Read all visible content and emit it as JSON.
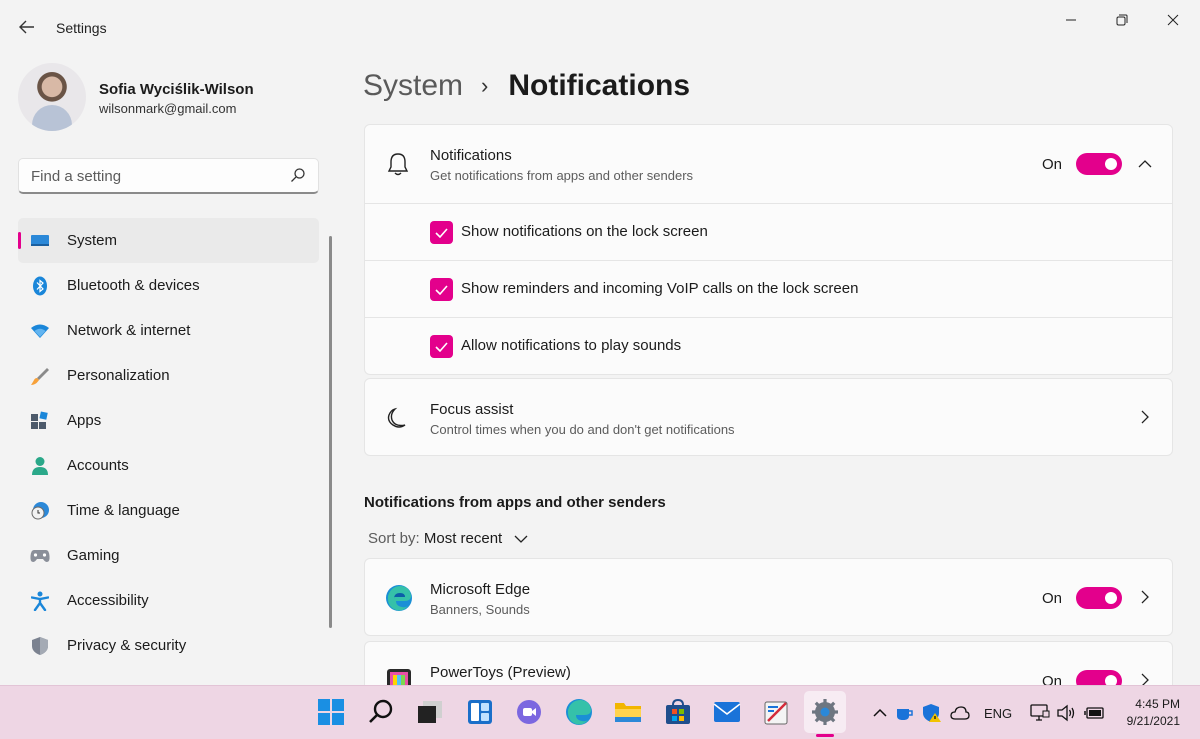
{
  "window": {
    "title": "Settings",
    "back_icon": "back-arrow-icon",
    "controls": [
      "minimize-icon",
      "maximize-icon",
      "close-icon"
    ]
  },
  "profile": {
    "name": "Sofia Wyciślik-Wilson",
    "email": "wilsonmark@gmail.com"
  },
  "search": {
    "placeholder": "Find a setting",
    "icon": "search-icon"
  },
  "sidebar": {
    "items": [
      {
        "label": "System",
        "icon": "system-display-icon",
        "active": true
      },
      {
        "label": "Bluetooth & devices",
        "icon": "bluetooth-icon"
      },
      {
        "label": "Network & internet",
        "icon": "wifi-icon"
      },
      {
        "label": "Personalization",
        "icon": "brush-icon"
      },
      {
        "label": "Apps",
        "icon": "apps-icon"
      },
      {
        "label": "Accounts",
        "icon": "accounts-icon"
      },
      {
        "label": "Time & language",
        "icon": "clock-globe-icon"
      },
      {
        "label": "Gaming",
        "icon": "gamepad-icon"
      },
      {
        "label": "Accessibility",
        "icon": "accessibility-icon"
      },
      {
        "label": "Privacy & security",
        "icon": "shield-icon"
      }
    ]
  },
  "breadcrumb": {
    "parent": "System",
    "separator": "›",
    "current": "Notifications"
  },
  "notifications_card": {
    "title": "Notifications",
    "subtitle": "Get notifications from apps and other senders",
    "state_label": "On",
    "toggle_on": true,
    "icon": "bell-icon",
    "options": [
      {
        "label": "Show notifications on the lock screen",
        "checked": true
      },
      {
        "label": "Show reminders and incoming VoIP calls on the lock screen",
        "checked": true
      },
      {
        "label": "Allow notifications to play sounds",
        "checked": true
      }
    ]
  },
  "focus_assist": {
    "title": "Focus assist",
    "subtitle": "Control times when you do and don't get notifications",
    "icon": "moon-icon"
  },
  "apps_section": {
    "title": "Notifications from apps and other senders",
    "sort_label": "Sort by:",
    "sort_value": "Most recent",
    "apps": [
      {
        "name": "Microsoft Edge",
        "detail": "Banners, Sounds",
        "state_label": "On",
        "toggle_on": true,
        "icon": "edge-icon"
      },
      {
        "name": "PowerToys (Preview)",
        "detail": "",
        "state_label": "On",
        "toggle_on": true,
        "icon": "powertoys-icon"
      }
    ]
  },
  "taskbar": {
    "icons": [
      "start-icon",
      "search-icon",
      "task-view-icon",
      "widgets-icon",
      "chat-icon",
      "edge-icon",
      "file-explorer-icon",
      "store-icon",
      "mail-icon",
      "snipping-icon",
      "settings-icon"
    ],
    "tray_language": "ENG",
    "time": "4:45 PM",
    "date": "9/21/2021"
  },
  "colors": {
    "accent": "#e3008c",
    "background": "#f3f3f3",
    "card": "#fbfbfb",
    "taskbar": "#eed6e4"
  }
}
